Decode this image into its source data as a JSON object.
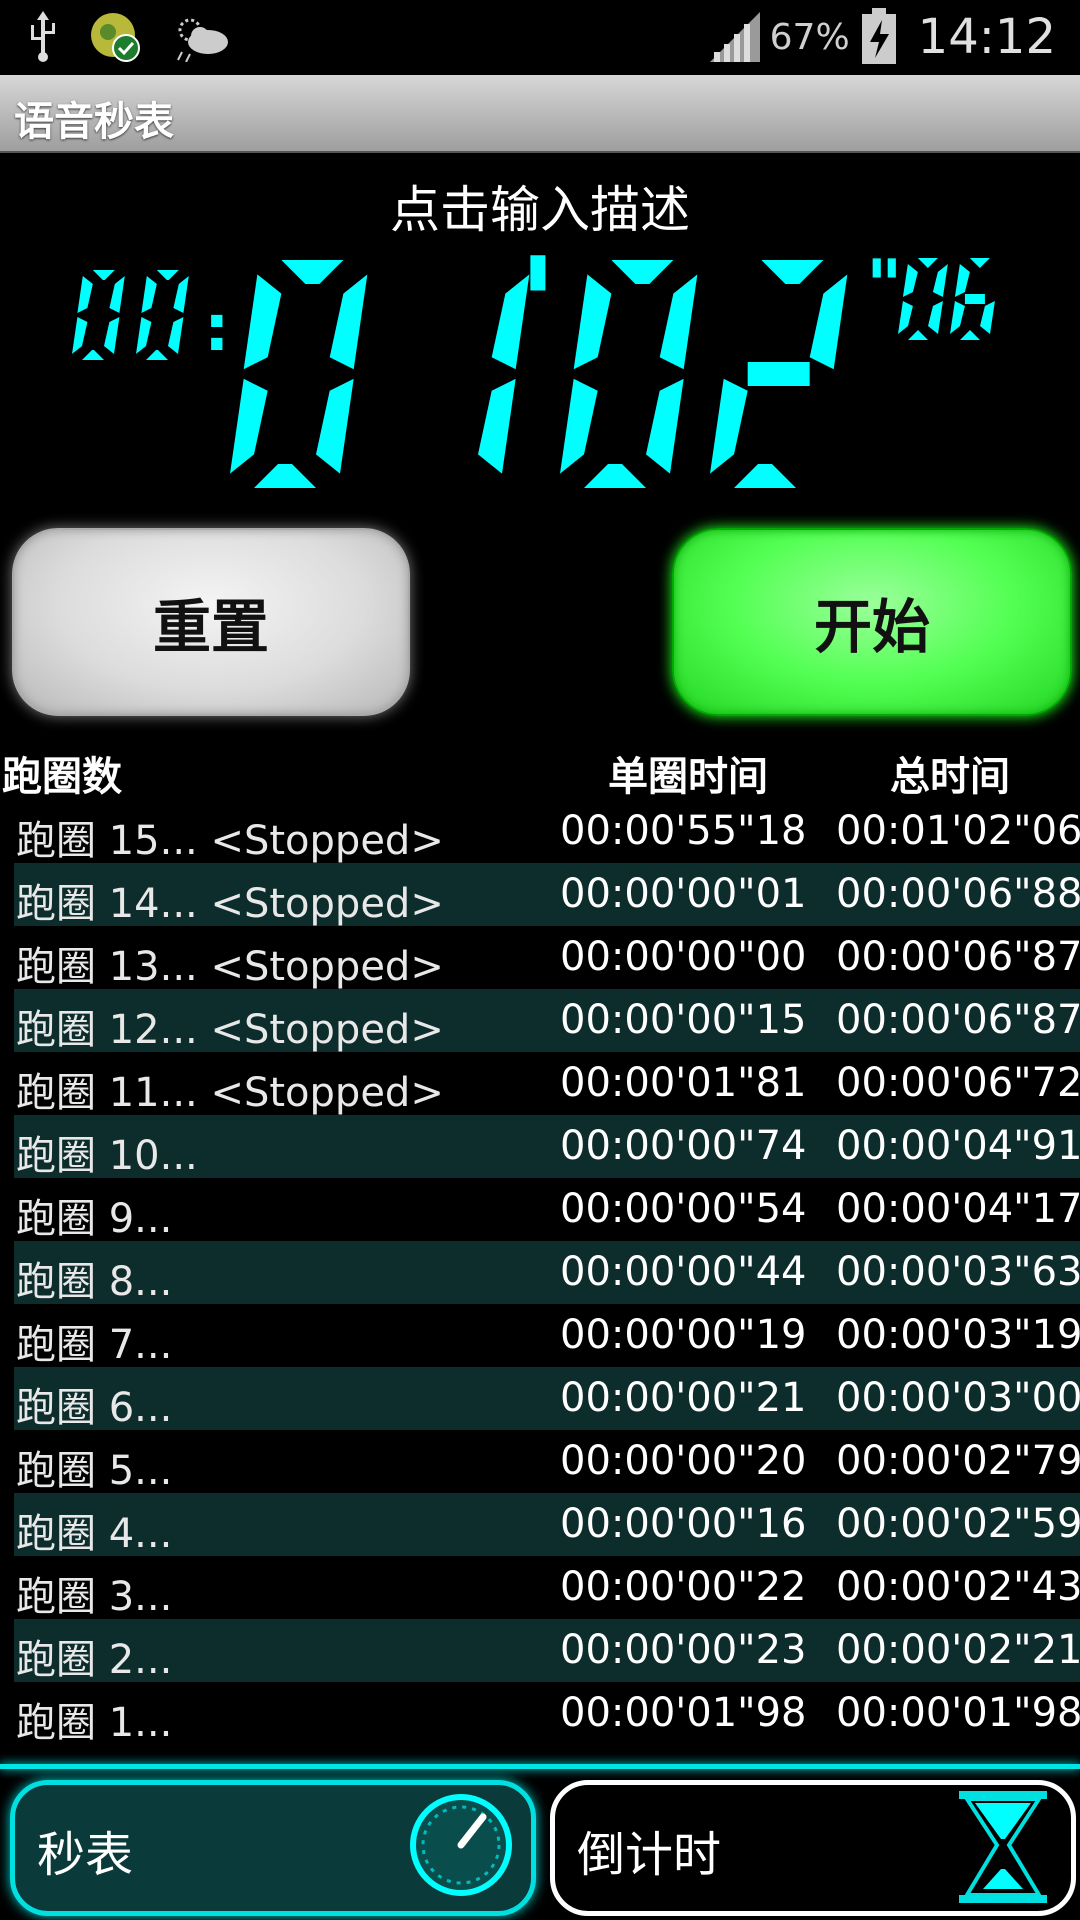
{
  "status_bar": {
    "battery_percent": "67%",
    "time": "14:12",
    "icons": [
      "usb-icon",
      "notification-app-icon",
      "weather-icon",
      "signal-icon",
      "battery-charging-icon"
    ]
  },
  "app": {
    "title": "语音秒表"
  },
  "description_prompt": "点击输入描述",
  "timer": {
    "hours": "00",
    "minutes": "01",
    "seconds": "02",
    "hundredths": "06",
    "hours_sep": ":",
    "min_sep": "'",
    "sec_sep": "\""
  },
  "buttons": {
    "reset": "重置",
    "start": "开始"
  },
  "laps": {
    "headers": {
      "lap": "跑圈数",
      "split": "单圈时间",
      "total": "总时间"
    },
    "rows": [
      {
        "lap": "跑圈 15... <Stopped>",
        "split": "00:00'55\"18",
        "total": "00:01'02\"06"
      },
      {
        "lap": "跑圈 14... <Stopped>",
        "split": "00:00'00\"01",
        "total": "00:00'06\"88"
      },
      {
        "lap": "跑圈 13... <Stopped>",
        "split": "00:00'00\"00",
        "total": "00:00'06\"87"
      },
      {
        "lap": "跑圈 12... <Stopped>",
        "split": "00:00'00\"15",
        "total": "00:00'06\"87"
      },
      {
        "lap": "跑圈 11... <Stopped>",
        "split": "00:00'01\"81",
        "total": "00:00'06\"72"
      },
      {
        "lap": "跑圈 10...",
        "split": "00:00'00\"74",
        "total": "00:00'04\"91"
      },
      {
        "lap": "跑圈 9...",
        "split": "00:00'00\"54",
        "total": "00:00'04\"17"
      },
      {
        "lap": "跑圈 8...",
        "split": "00:00'00\"44",
        "total": "00:00'03\"63"
      },
      {
        "lap": "跑圈 7...",
        "split": "00:00'00\"19",
        "total": "00:00'03\"19"
      },
      {
        "lap": "跑圈 6...",
        "split": "00:00'00\"21",
        "total": "00:00'03\"00"
      },
      {
        "lap": "跑圈 5...",
        "split": "00:00'00\"20",
        "total": "00:00'02\"79"
      },
      {
        "lap": "跑圈 4...",
        "split": "00:00'00\"16",
        "total": "00:00'02\"59"
      },
      {
        "lap": "跑圈 3...",
        "split": "00:00'00\"22",
        "total": "00:00'02\"43"
      },
      {
        "lap": "跑圈 2...",
        "split": "00:00'00\"23",
        "total": "00:00'02\"21"
      },
      {
        "lap": "跑圈 1...",
        "split": "00:00'01\"98",
        "total": "00:00'01\"98"
      }
    ]
  },
  "tabs": {
    "stopwatch": "秒表",
    "countdown": "倒计时"
  },
  "colors": {
    "accent": "#00ffff",
    "start_green": "#44ff44",
    "alt_row": "#0d2c2c"
  }
}
